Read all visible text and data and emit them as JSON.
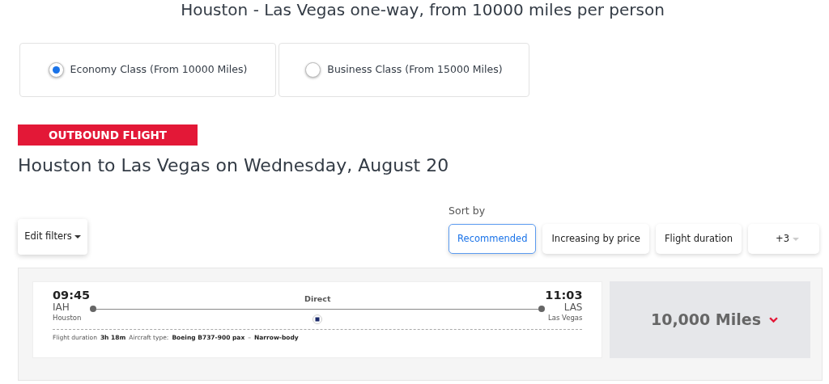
{
  "title": "Houston - Las Vegas one-way, from 10000 miles per person",
  "cabins": [
    {
      "label": "Economy Class (From 10000 Miles)",
      "selected": true
    },
    {
      "label": "Business Class (From 15000 Miles)",
      "selected": false
    }
  ],
  "section_banner": "OUTBOUND FLIGHT",
  "route_heading": "Houston to Las Vegas on Wednesday, August 20",
  "filters_button": "Edit filters",
  "sort": {
    "label": "Sort by",
    "options": [
      {
        "label": "Recommended",
        "selected": true
      },
      {
        "label": "Increasing by price",
        "selected": false
      },
      {
        "label": "Flight duration",
        "selected": false
      },
      {
        "label": "+3",
        "selected": false
      }
    ]
  },
  "flights": [
    {
      "depart_time": "09:45",
      "depart_code": "IAH",
      "depart_city": "Houston",
      "stops": "Direct",
      "arrive_time": "11:03",
      "arrive_code": "LAS",
      "arrive_city": "Las Vegas",
      "duration_label": "Flight duration",
      "duration": "3h 18m",
      "aircraft_label": "Aircraft type:",
      "aircraft": "Boeing B737-900 pax",
      "separator": "–",
      "body": "Narrow-body",
      "price": "10,000 Miles"
    }
  ]
}
